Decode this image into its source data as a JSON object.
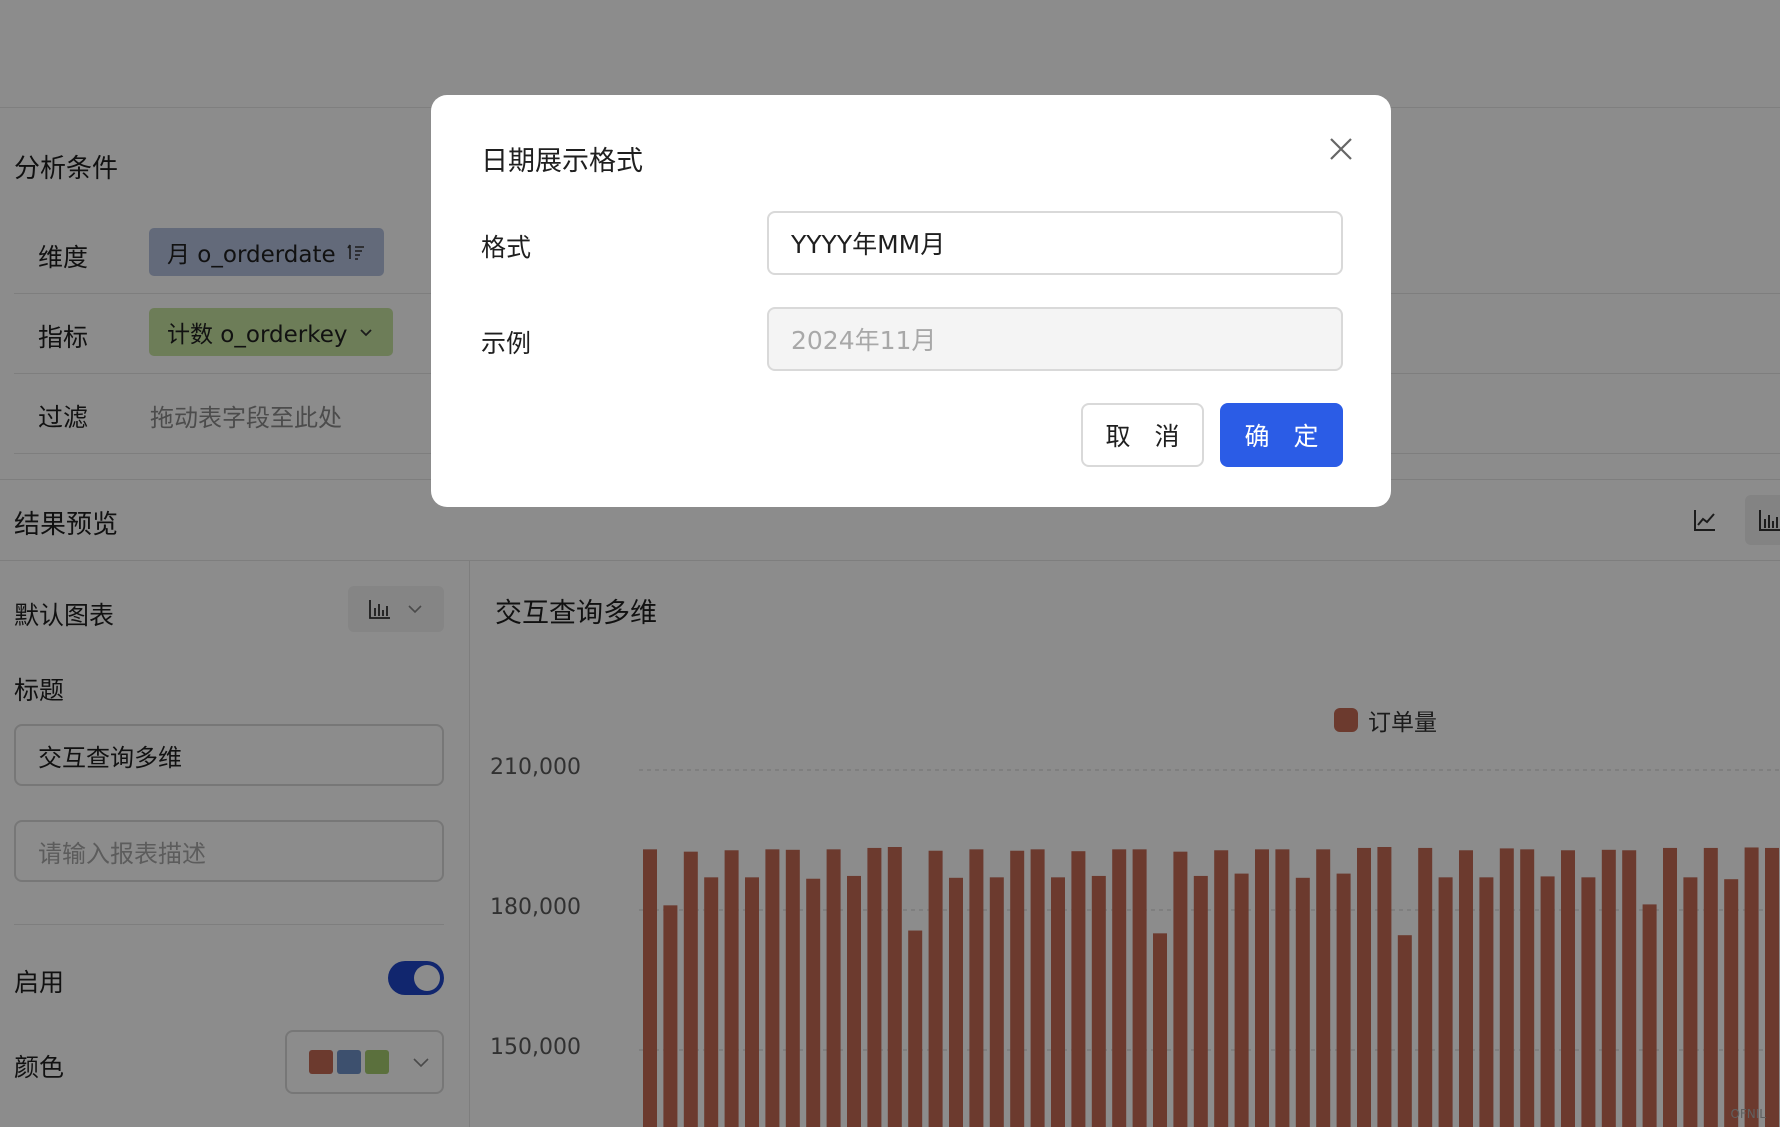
{
  "colors": {
    "bar": "#c56a55",
    "primary": "#2b5ce6",
    "toggle_on": "#1f46c8",
    "dim_chip": "#b4c1df",
    "metric_chip": "#c6e3a1",
    "palette": [
      "#c56a55",
      "#6f93c8",
      "#a6cc6f"
    ]
  },
  "analysis": {
    "title": "分析条件",
    "dimension_label": "维度",
    "dimension_chip": "月 o_orderdate",
    "dimension_icon": "sort-ascending-icon",
    "metric_label": "指标",
    "metric_chip": "计数 o_orderkey",
    "filter_label": "过滤",
    "filter_placeholder": "拖动表字段至此处"
  },
  "preview": {
    "title": "结果预览",
    "toggles": [
      "line-chart-icon",
      "bar-chart-icon"
    ]
  },
  "settings": {
    "default_chart_label": "默认图表",
    "title_label": "标题",
    "title_value": "交互查询多维",
    "desc_placeholder": "请输入报表描述",
    "enable_label": "启用",
    "enable_on": true,
    "color_label": "颜色"
  },
  "chart_data": {
    "type": "bar",
    "title": "交互查询多维",
    "legend": [
      "订单量"
    ],
    "legend_position": "top-center",
    "y_ticks": [
      "210,000",
      "180,000",
      "150,000"
    ],
    "ylim_visible": [
      136000,
      215000
    ],
    "grid": true,
    "series": [
      {
        "name": "订单量",
        "values": [
          193000,
          181000,
          192500,
          187000,
          192800,
          187000,
          193000,
          192900,
          186700,
          193000,
          187300,
          193300,
          193500,
          175600,
          192700,
          186900,
          193000,
          187000,
          192700,
          193000,
          187000,
          192600,
          187300,
          193000,
          193000,
          175000,
          192500,
          187300,
          192800,
          187800,
          193000,
          193000,
          186900,
          193000,
          187800,
          193300,
          193500,
          174600,
          193300,
          187000,
          192800,
          187000,
          193200,
          193000,
          187200,
          192800,
          187000,
          192900,
          192800,
          181200,
          193300,
          187000,
          193300,
          186600,
          193400,
          193300
        ]
      }
    ],
    "watermark": "OFNIL"
  },
  "dialog": {
    "title": "日期展示格式",
    "format_label": "格式",
    "format_value": "YYYY年MM月",
    "example_label": "示例",
    "example_value": "2024年11月",
    "cancel": "取 消",
    "confirm": "确 定"
  }
}
